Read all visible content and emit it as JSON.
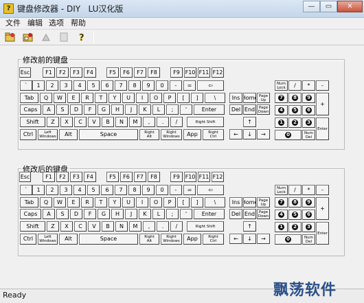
{
  "window": {
    "title": "键盘修改器 - DIY   LU汉化版",
    "icon_text": "?",
    "controls": [
      "minimize-icon",
      "maximize-icon",
      "close-icon"
    ]
  },
  "menu": [
    "文件",
    "编辑",
    "选项",
    "帮助"
  ],
  "toolbar": [
    "open-folder-icon",
    "save-icon",
    "run-icon",
    "disabled-doc-icon",
    "help-icon"
  ],
  "groups": [
    {
      "label": "修改前的键盘",
      "keyboard": "before"
    },
    {
      "label": "修改后的键盘",
      "keyboard": "after"
    }
  ],
  "keyboard": {
    "rows": {
      "fn": [
        "Esc",
        "F1",
        "F2",
        "F3",
        "F4",
        "F5",
        "F6",
        "F7",
        "F8",
        "F9",
        "F10",
        "F11",
        "F12"
      ],
      "num": [
        "`",
        "1",
        "2",
        "3",
        "4",
        "5",
        "6",
        "7",
        "8",
        "9",
        "0",
        "-",
        "=",
        "⇦"
      ],
      "q": [
        "Tab",
        "Q",
        "W",
        "E",
        "R",
        "T",
        "Y",
        "U",
        "I",
        "O",
        "P",
        "[",
        "]",
        "\\"
      ],
      "a": [
        "Caps",
        "A",
        "S",
        "D",
        "F",
        "G",
        "H",
        "J",
        "K",
        "L",
        ";",
        "'",
        "Enter"
      ],
      "z": [
        "Shift",
        "Z",
        "X",
        "C",
        "V",
        "B",
        "N",
        "M",
        ",",
        ".",
        "/",
        "Right Shift"
      ],
      "bottom": [
        "Ctrl",
        "Left\nWindows",
        "Alt",
        "Space",
        "Right\nAlt",
        "Right\nWindows",
        "App",
        "Right\nCtrl"
      ]
    },
    "nav": [
      "Ins",
      "Home",
      "Page\nUp",
      "Del",
      "End",
      "Page\nDown"
    ],
    "arrows": [
      "↑",
      "←",
      "↓",
      "→"
    ],
    "numpad": {
      "top": [
        "Num\nLock",
        "/",
        "*",
        "-"
      ],
      "r1": [
        "7",
        "8",
        "9"
      ],
      "r2": [
        "4",
        "5",
        "6"
      ],
      "r3": [
        "1",
        "2",
        "3"
      ],
      "plus": "+",
      "enter": "Enter",
      "zero": "0",
      "del": "Num\nDel"
    }
  },
  "status": "Ready",
  "watermark": "飘荡软件"
}
